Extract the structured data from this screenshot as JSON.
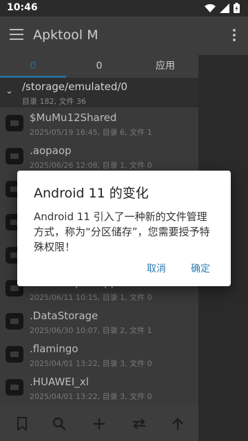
{
  "status": {
    "time": "10:46"
  },
  "app": {
    "title": "Apktool M"
  },
  "tabs": [
    {
      "label": "0"
    },
    {
      "label": "0"
    },
    {
      "label": "应用"
    }
  ],
  "path": {
    "current": "/storage/emulated/0",
    "summary": "目录 182, 文件 36"
  },
  "files": [
    {
      "name": "$MuMu12Shared",
      "info": "2025/05/19 16:45, 目录 6, 文件 1"
    },
    {
      "name": ".aopaop",
      "info": "2025/06/26 12:08, 目录 1, 文件 0"
    },
    {
      "name": "",
      "info": ""
    },
    {
      "name": "",
      "info": ""
    },
    {
      "name": "",
      "info": ""
    },
    {
      "name": ".ohmobopen.app",
      "info": "2025/06/11 10:15, 目录 1, 文件 0"
    },
    {
      "name": ".DataStorage",
      "info": "2025/06/30 10:07, 目录 2, 文件 1"
    },
    {
      "name": ".flamingo",
      "info": "2025/04/01 13:22, 目录 3, 文件 0"
    },
    {
      "name": ".HUAWEI_xl",
      "info": "2025/04/01 13:22, 目录 3, 文件 0"
    }
  ],
  "dialog": {
    "title": "Android 11 的变化",
    "message": "Android 11 引入了一种新的文件管理方式，称为“分区储存”，您需要授予特殊权限！",
    "cancel": "取消",
    "confirm": "确定"
  },
  "colors": {
    "accent": "#2d6e98",
    "dialog_button": "#2e7eb3"
  }
}
